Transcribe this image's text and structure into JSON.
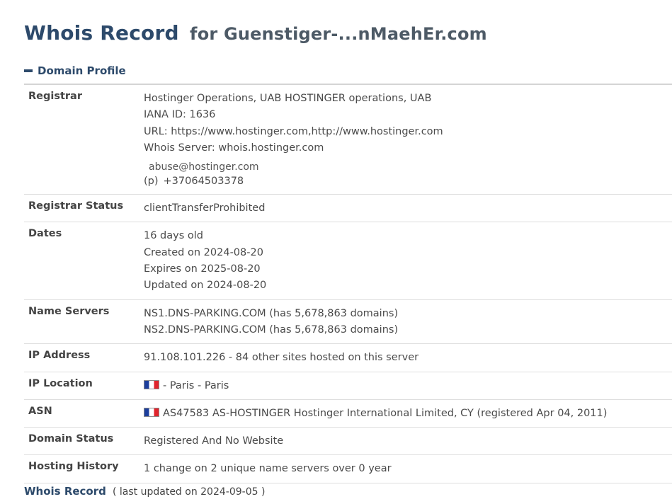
{
  "header": {
    "title": "Whois Record",
    "subtitle": "for Guenstiger-...nMaehEr.com"
  },
  "section": {
    "label": "Domain Profile"
  },
  "profile": {
    "registrar": {
      "label": "Registrar",
      "lines": [
        "Hostinger Operations, UAB HOSTINGER operations, UAB",
        "IANA ID: 1636",
        "URL: https://www.hostinger.com,http://www.hostinger.com",
        "Whois Server: whois.hostinger.com"
      ],
      "email": "abuse@hostinger.com",
      "phone_prefix": "(p)",
      "phone": "+37064503378"
    },
    "registrar_status": {
      "label": "Registrar Status",
      "value": "clientTransferProhibited"
    },
    "dates": {
      "label": "Dates",
      "lines": [
        "16 days old",
        "Created on 2024-08-20",
        "Expires on 2025-08-20",
        "Updated on 2024-08-20"
      ]
    },
    "name_servers": {
      "label": "Name Servers",
      "lines": [
        "NS1.DNS-PARKING.COM (has 5,678,863 domains)",
        "NS2.DNS-PARKING.COM (has 5,678,863 domains)"
      ]
    },
    "ip_address": {
      "label": "IP Address",
      "value": "91.108.101.226 - 84 other sites hosted on this server"
    },
    "ip_location": {
      "label": "IP Location",
      "value": "- Paris - Paris"
    },
    "asn": {
      "label": "ASN",
      "value": "AS47583 AS-HOSTINGER Hostinger International Limited, CY (registered Apr 04, 2011)"
    },
    "domain_status": {
      "label": "Domain Status",
      "value": "Registered And No Website"
    },
    "hosting_history": {
      "label": "Hosting History",
      "value": "1 change on 2 unique name servers over 0 year"
    }
  },
  "footer": {
    "label": "Whois Record",
    "updated": "( last updated on 2024-09-05 )"
  }
}
